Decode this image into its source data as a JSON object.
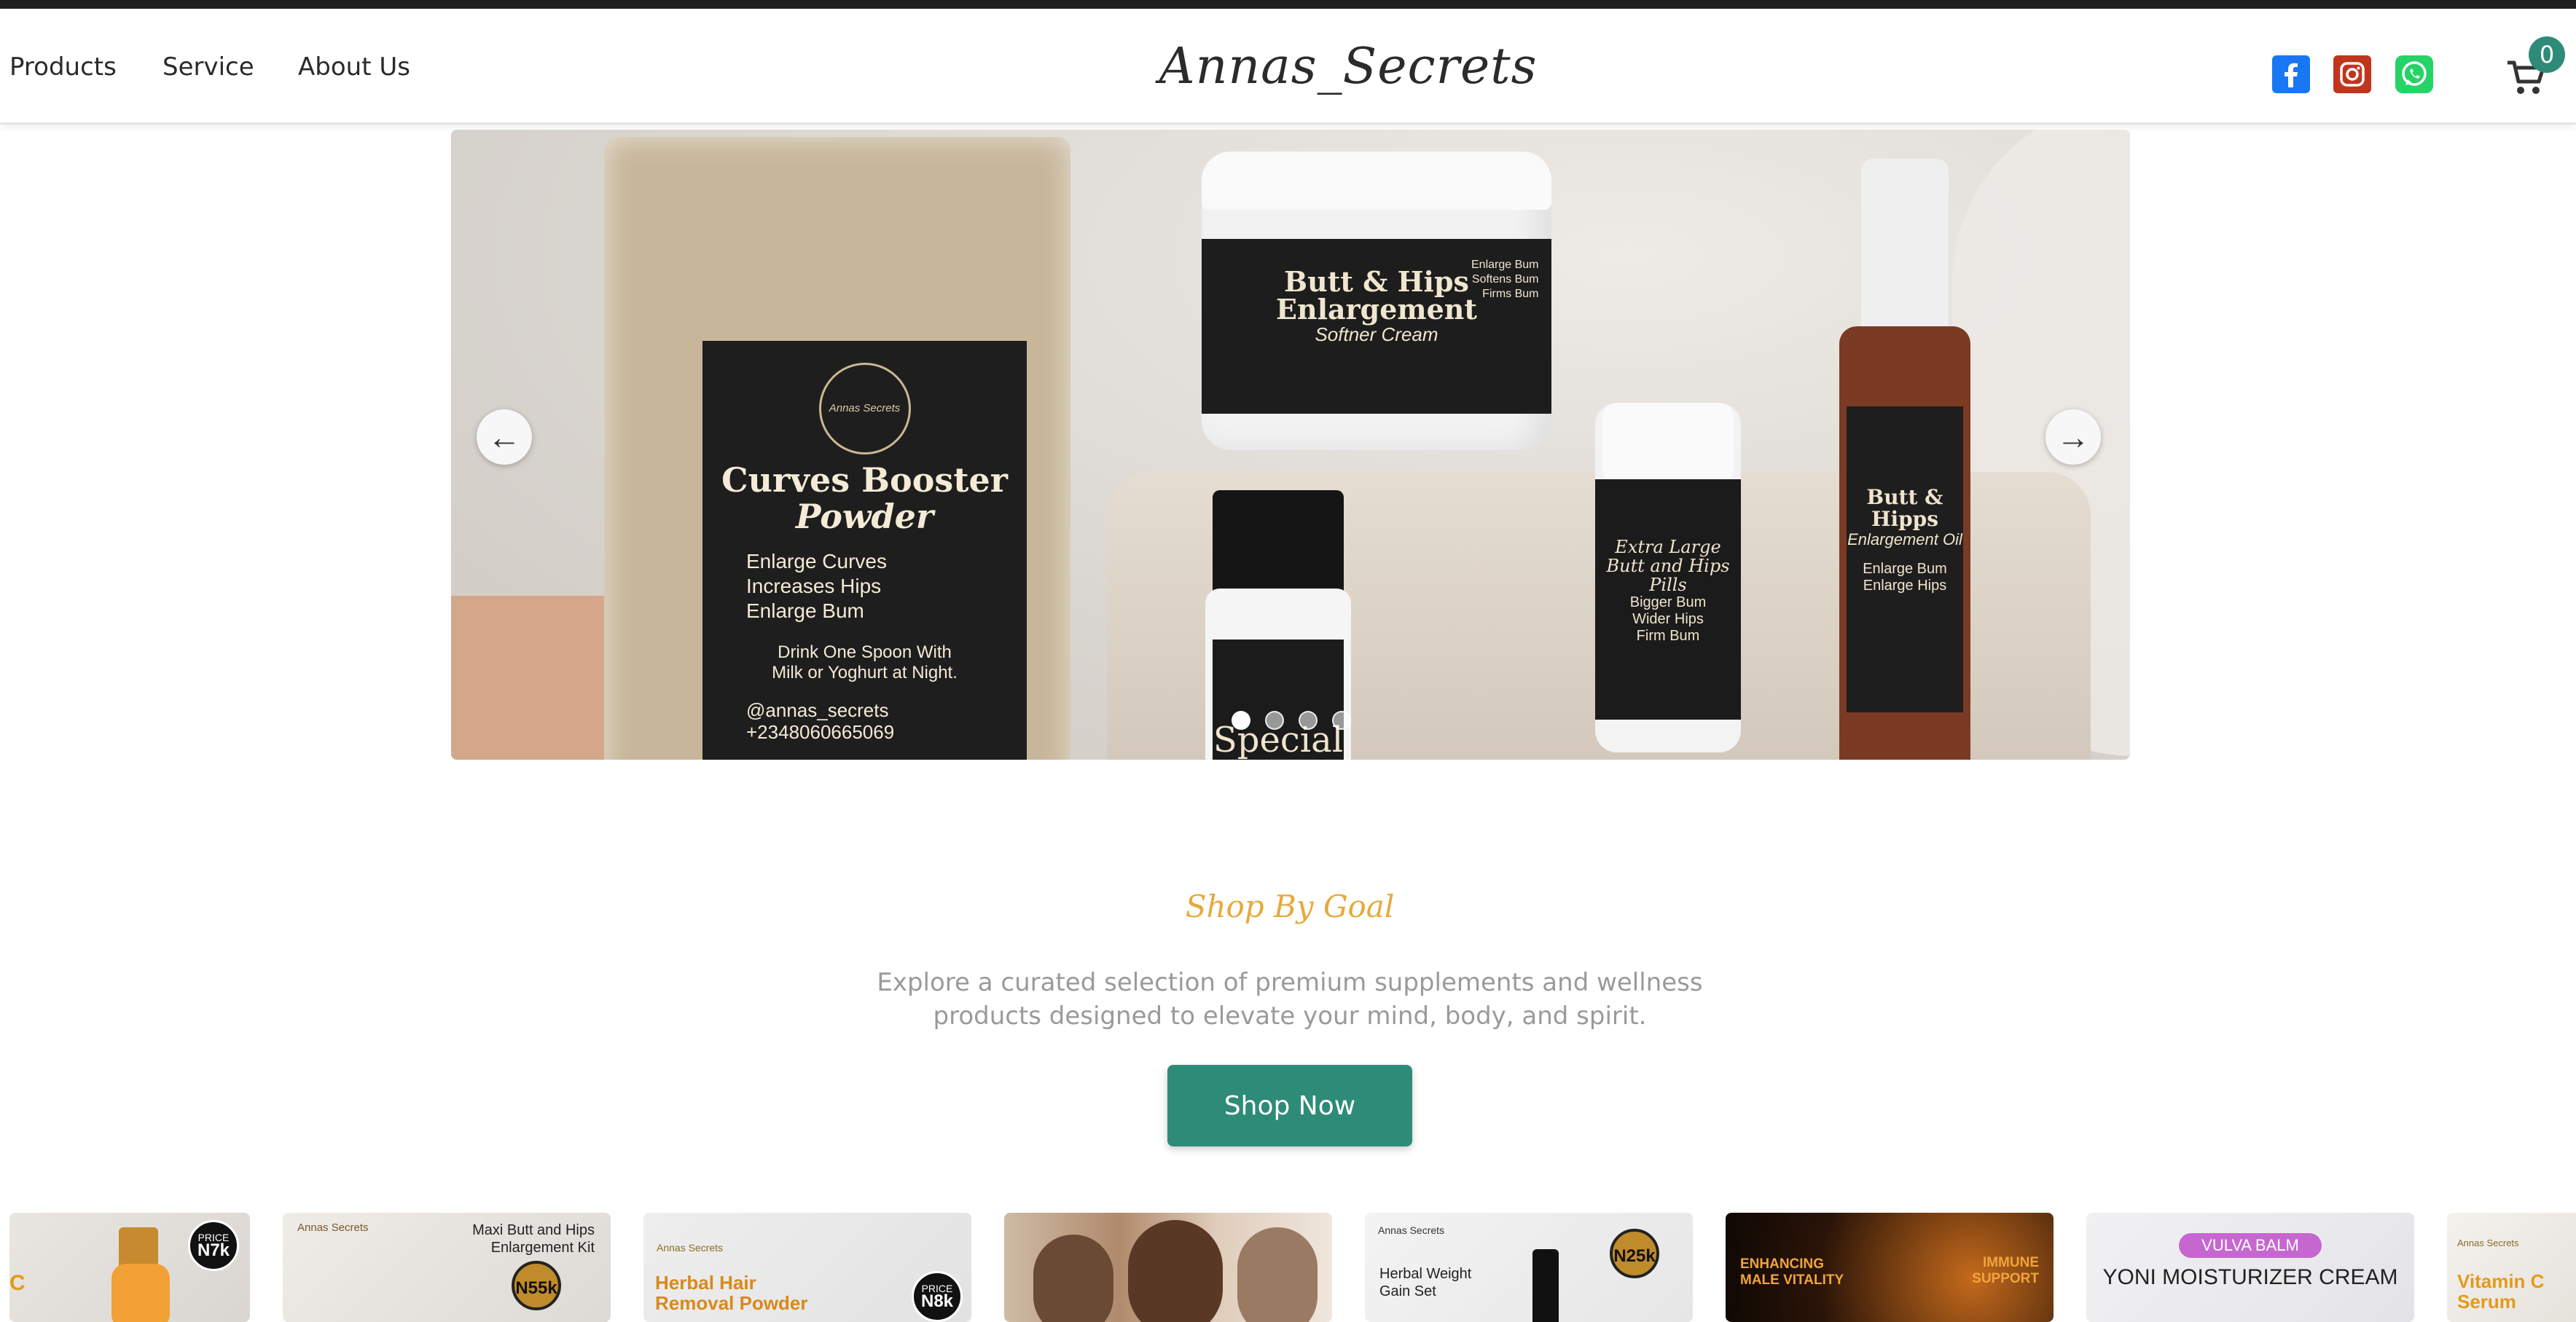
{
  "header": {
    "nav": [
      "Products",
      "Service",
      "About Us"
    ],
    "logo": "Annas_Secrets",
    "cart_count": "0"
  },
  "colors": {
    "brand": "#2e8b78",
    "accent": "#e6a93c",
    "facebook": "#1877f2",
    "instagram": "#c1351d",
    "whatsapp": "#25d366"
  },
  "icons": [
    "facebook-icon",
    "instagram-icon",
    "whatsapp-icon",
    "cart-icon",
    "arrow-left-icon",
    "arrow-right-icon"
  ],
  "carousel": {
    "prev": "←",
    "next": "→",
    "slide_count": 4,
    "active_slide": 1,
    "packet": {
      "brand": "Annas Secrets",
      "title1": "Curves Booster",
      "title2": "Powder",
      "benefits": [
        "Enlarge Curves",
        "Increases Hips",
        "Enlarge Bum"
      ],
      "usage1": "Drink One Spoon With",
      "usage2": "Milk or Yoghurt at Night.",
      "handle": "@annas_secrets",
      "phone": "+2348060665069"
    },
    "jar": {
      "title1": "Butt & Hips",
      "title2": "Enlargement",
      "subtitle": "Softner Cream",
      "side": [
        "Enlarge Bum",
        "Softens Bum",
        "Firms Bum"
      ]
    },
    "bottle": {
      "text": "Special"
    },
    "pills": {
      "title": "Extra Large Butt and Hips Pills",
      "lines": [
        "Bigger Bum",
        "Wider Hips",
        "Firm Bum"
      ]
    },
    "spray": {
      "title1": "Butt & Hipps",
      "title2": "Enlargement Oil",
      "lines": [
        "Enlarge Bum",
        "Enlarge Hips"
      ]
    }
  },
  "shop_by_goal": {
    "title": "Shop By Goal",
    "desc1": "Explore a curated selection of premium supplements and wellness",
    "desc2": "products designed to elevate your mind, body, and spirit.",
    "button": "Shop Now"
  },
  "products": [
    {
      "label": "C",
      "price_label": "PRICE",
      "price": "N7k"
    },
    {
      "brand": "Annas Secrets",
      "title1": "Maxi Butt and Hips",
      "title2": "Enlargement Kit",
      "price": "N55k"
    },
    {
      "brand": "Annas Secrets",
      "title1": "Herbal Hair",
      "title2": "Removal Powder",
      "price_label": "PRICE",
      "price": "N8k"
    },
    {
      "label": ""
    },
    {
      "brand": "Annas Secrets",
      "title1": "Herbal Weight",
      "title2": "Gain Set",
      "price": "N25k"
    },
    {
      "left1": "ENHANCING",
      "left2": "MALE VITALITY",
      "right1": "IMMUNE",
      "right2": "SUPPORT"
    },
    {
      "tag": "VULVA BALM",
      "title": "YONI MOISTURIZER CREAM"
    },
    {
      "brand": "Annas Secrets",
      "title1": "Vitamin C",
      "title2": "Serum"
    }
  ]
}
